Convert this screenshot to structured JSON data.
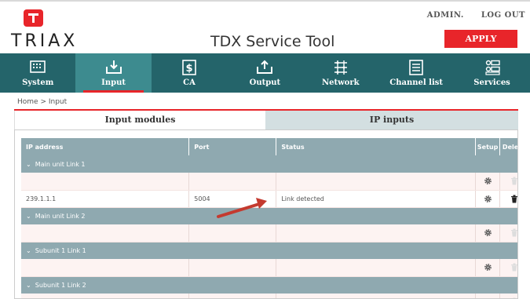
{
  "brand": {
    "name": "TRIAX",
    "logo_icon": "triax-logo-icon"
  },
  "app_title": "TDX Service Tool",
  "header_links": {
    "admin": "ADMIN.",
    "logout": "LOG OUT"
  },
  "apply_label": "APPLY",
  "nav": [
    {
      "label": "System",
      "icon": "system-icon",
      "active": false
    },
    {
      "label": "Input",
      "icon": "input-download-icon",
      "active": true
    },
    {
      "label": "CA",
      "icon": "ca-dollar-icon",
      "active": false
    },
    {
      "label": "Output",
      "icon": "output-upload-icon",
      "active": false
    },
    {
      "label": "Network",
      "icon": "network-icon",
      "active": false
    },
    {
      "label": "Channel list",
      "icon": "channel-list-icon",
      "active": false
    },
    {
      "label": "Services",
      "icon": "services-icon",
      "active": false
    }
  ],
  "breadcrumb": "Home > Input",
  "tabs": [
    {
      "label": "Input modules",
      "active": true
    },
    {
      "label": "IP inputs",
      "active": false
    }
  ],
  "table": {
    "headers": {
      "ip": "IP address",
      "port": "Port",
      "status": "Status",
      "setup": "Setup",
      "delete": "Delete"
    },
    "groups": [
      {
        "label": "Main unit Link 1",
        "rows": [
          {
            "ip": "",
            "port": "",
            "status": "",
            "delete_enabled": false
          },
          {
            "ip": "239.1.1.1",
            "port": "5004",
            "status": "Link detected",
            "delete_enabled": true
          }
        ]
      },
      {
        "label": "Main unit Link 2",
        "rows": [
          {
            "ip": "",
            "port": "",
            "status": "",
            "delete_enabled": false
          }
        ]
      },
      {
        "label": "Subunit 1 Link 1",
        "rows": [
          {
            "ip": "",
            "port": "",
            "status": "",
            "delete_enabled": false
          }
        ]
      },
      {
        "label": "Subunit 1 Link 2",
        "rows": [
          {
            "ip": "",
            "port": "",
            "status": "",
            "delete_enabled": false
          }
        ]
      }
    ]
  },
  "colors": {
    "brand_red": "#e8252a",
    "nav_teal": "#24646a",
    "nav_active": "#3d8b8f",
    "table_header": "#8fa9b0",
    "annotation_arrow": "#c43a2f"
  }
}
